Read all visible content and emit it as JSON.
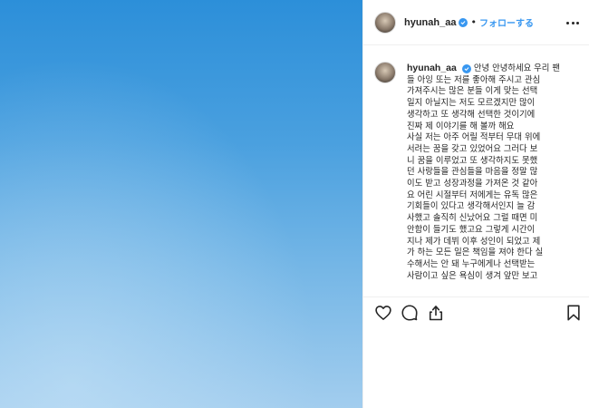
{
  "post": {
    "username": "hyunah_aa",
    "separator": "•",
    "follow_label": "フォローする",
    "caption_lines": [
      "안녕 안녕하세요 우리 팬",
      "들 아잉 또는 저를 좋아해 주시고 관심",
      "가져주시는 많은 분들 이게 맞는 선택",
      "일지 아닐지는 저도 모르겠지만 많이",
      "생각하고 또 생각해 선택한 것이기에",
      "진짜 제 이야기를 해 볼까 해요",
      "사실 저는 아주 어릴 적부터 무대 위에",
      "서려는 꿈을 갖고 있었어요 그러다 보",
      "니 꿈을 이루었고 또 생각하지도 못했",
      "던 사랑들을 관심들을 마음을 정말 많",
      "이도 받고 성장과정을 가져온 것 같아",
      "요 어린 시절부터 저에게는 유독 많은",
      "기회들이 있다고 생각해서인지 늘 감",
      "사했고 솔직히 신났어요 그럴 때면 미",
      "안함이 들기도 했고요 그렇게 시간이",
      "지나 제가 데뷔 이후 성인이 되었고 제",
      "가 하는 모든 일은 책임을 져야 한다 실",
      "수해서는 안 돼 누구에게나 선택받는",
      "사람이고 싶은 욕심이 생겨 앞만 보고"
    ]
  },
  "colors": {
    "accent": "#3897f0",
    "text": "#262626",
    "border": "#efefef",
    "sky_top": "#2c8fd9",
    "sky_bottom": "#a2cdee"
  },
  "icons": {
    "like": "heart-icon",
    "comment": "comment-icon",
    "share": "share-icon",
    "save": "bookmark-icon",
    "more": "more-options-icon",
    "verified": "verified-badge-icon"
  }
}
